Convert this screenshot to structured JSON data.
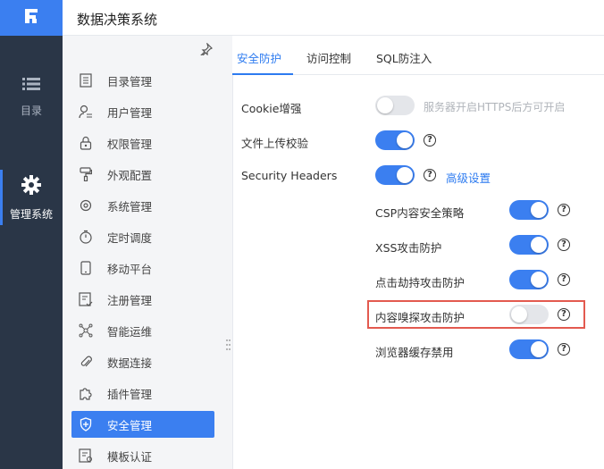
{
  "app": {
    "title": "数据决策系统"
  },
  "rail": {
    "items": [
      {
        "label": "目录",
        "icon": "list-icon"
      },
      {
        "label": "管理系统",
        "icon": "gear-icon"
      }
    ]
  },
  "sidebar": {
    "items": [
      {
        "label": "目录管理",
        "icon": "catalog-icon"
      },
      {
        "label": "用户管理",
        "icon": "user-icon"
      },
      {
        "label": "权限管理",
        "icon": "lock-icon"
      },
      {
        "label": "外观配置",
        "icon": "paint-roller-icon"
      },
      {
        "label": "系统管理",
        "icon": "gear-icon"
      },
      {
        "label": "定时调度",
        "icon": "timer-icon"
      },
      {
        "label": "移动平台",
        "icon": "mobile-icon"
      },
      {
        "label": "注册管理",
        "icon": "register-icon"
      },
      {
        "label": "智能运维",
        "icon": "network-icon"
      },
      {
        "label": "数据连接",
        "icon": "paperclip-icon"
      },
      {
        "label": "插件管理",
        "icon": "puzzle-icon"
      },
      {
        "label": "安全管理",
        "icon": "shield-icon",
        "active": true
      },
      {
        "label": "模板认证",
        "icon": "certificate-icon"
      }
    ]
  },
  "tabs": [
    {
      "label": "安全防护",
      "active": true
    },
    {
      "label": "访问控制"
    },
    {
      "label": "SQL防注入"
    }
  ],
  "settings": {
    "cookie": {
      "label": "Cookie增强",
      "enabled": false,
      "hint": "服务器开启HTTPS后方可开启"
    },
    "upload": {
      "label": "文件上传校验",
      "enabled": true,
      "help": "?"
    },
    "security_headers": {
      "label": "Security Headers",
      "enabled": true,
      "help": "?",
      "link": "高级设置"
    },
    "sub": [
      {
        "label": "CSP内容安全策略",
        "enabled": true,
        "help": "?"
      },
      {
        "label": "XSS攻击防护",
        "enabled": true,
        "help": "?"
      },
      {
        "label": "点击劫持攻击防护",
        "enabled": true,
        "help": "?"
      },
      {
        "label": "内容嗅探攻击防护",
        "enabled": false,
        "help": "?",
        "highlighted": true
      },
      {
        "label": "浏览器缓存禁用",
        "enabled": true,
        "help": "?"
      }
    ]
  },
  "colors": {
    "accent": "#3b7ff0",
    "rail_bg": "#2a3647",
    "highlight": "#e35a4f"
  }
}
